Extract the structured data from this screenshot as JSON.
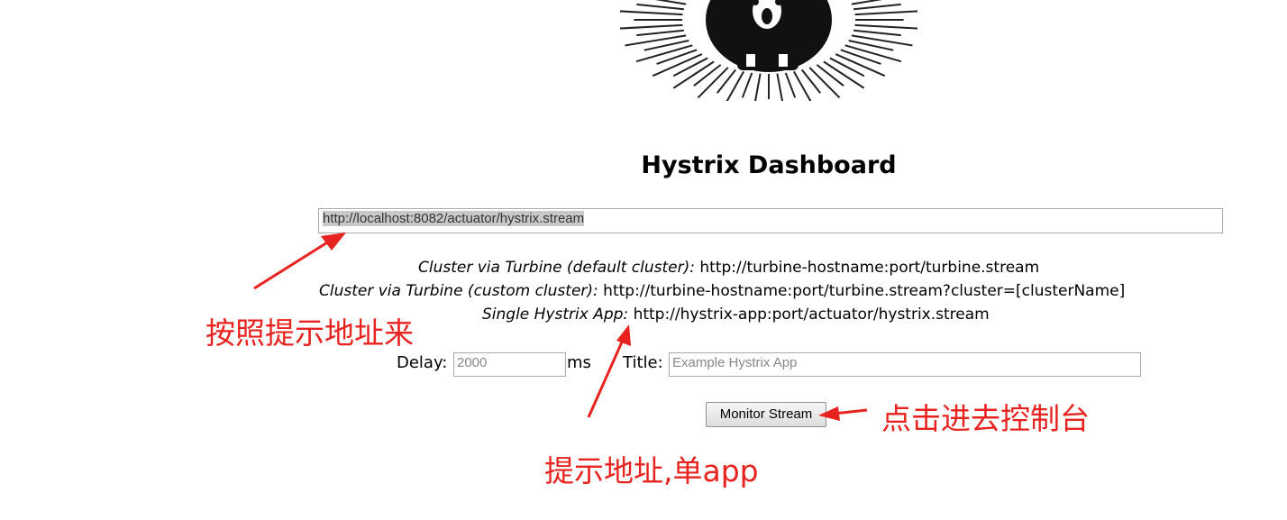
{
  "header": {
    "title": "Hystrix Dashboard"
  },
  "stream": {
    "value": "http://localhost:8082/actuator/hystrix.stream"
  },
  "hints": [
    {
      "label": "Cluster via Turbine (default cluster):",
      "url": "http://turbine-hostname:port/turbine.stream"
    },
    {
      "label": "Cluster via Turbine (custom cluster):",
      "url": "http://turbine-hostname:port/turbine.stream?cluster=[clusterName]"
    },
    {
      "label": "Single Hystrix App:",
      "url": "http://hystrix-app:port/actuator/hystrix.stream"
    }
  ],
  "form": {
    "delay_label": "Delay:",
    "delay_placeholder": "2000",
    "ms_label": "ms",
    "title_label": "Title:",
    "title_placeholder": "Example Hystrix App",
    "monitor_button": "Monitor Stream"
  },
  "annotations": {
    "note_address": "按照提示地址来",
    "note_console": "点击进去控制台",
    "note_single_app": "提示地址,单app",
    "color": "#e8231f"
  },
  "icons": {
    "logo": "hystrix-porcupine-logo",
    "arrows": "red-arrow"
  }
}
